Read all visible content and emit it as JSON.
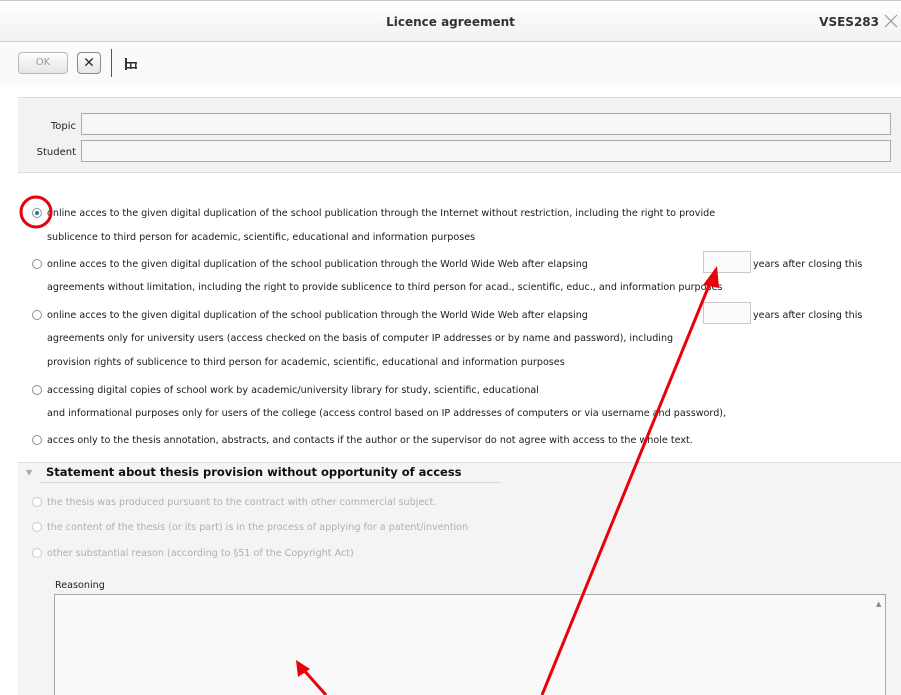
{
  "window": {
    "title": "Licence agreement",
    "code": "VSES283"
  },
  "toolbar": {
    "ok_label": "OK"
  },
  "form": {
    "topic_label": "Topic",
    "topic_value": "",
    "student_label": "Student",
    "student_value": ""
  },
  "options": [
    {
      "line1": "online acces to the given digital duplication of the school publication through the Internet without restriction, including the right to provide",
      "line2": "sublicence to third person for academic, scientific, educational and information purposes",
      "selected": true
    },
    {
      "line1": "online acces to the given digital duplication of the school publication through the World Wide Web after elapsing",
      "suffix": "years after closing this",
      "line2": "agreements without limitation, including the right to provide sublicence to third person for acad., scientific, educ., and information purposes",
      "selected": false
    },
    {
      "line1": "online acces to the given digital duplication of the school publication through the World Wide Web after elapsing",
      "suffix": "years after closing this",
      "line2": "agreements only for university users (access checked on the basis of computer IP addresses or by name and password), including",
      "line3": "provision rights of sublicence to third person for academic, scientific, educational and information purposes",
      "selected": false
    },
    {
      "line1": "accessing digital copies of school work by academic/university library for study, scientific, educational",
      "line2": "and informational purposes only for users of the college (access control based on IP addresses of computers or via username and password),",
      "selected": false
    },
    {
      "line1": "acces only to the thesis annotation, abstracts, and contacts if the author or the supervisor do not agree with access to the whole text.",
      "selected": false
    }
  ],
  "statement": {
    "title": "Statement about thesis provision without opportunity of access",
    "options": [
      "the thesis was produced pursuant to the contract with other commercial subject.",
      "the content of the thesis (or its part) is in the process of applying for a patent/invention",
      "other substantial reason (according to §51 of the Copyright Act)"
    ],
    "reasoning_label": "Reasoning",
    "reasoning_value": ""
  },
  "annotation_color": "#e8000b",
  "icons": [
    "close-icon",
    "x-icon",
    "grid-icon",
    "radio-icon",
    "triangle-icon",
    "scroll-up-icon"
  ]
}
